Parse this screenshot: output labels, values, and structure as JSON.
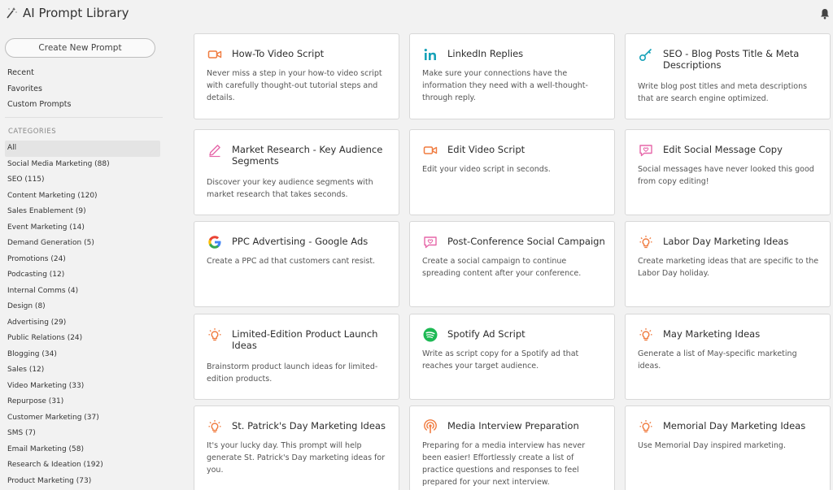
{
  "app": {
    "title": "AI Prompt Library"
  },
  "sidebar": {
    "create_label": "Create New Prompt",
    "links": [
      "Recent",
      "Favorites",
      "Custom Prompts"
    ],
    "categories_heading": "CATEGORIES",
    "categories": [
      "All",
      "Social Media Marketing (88)",
      "SEO (115)",
      "Content Marketing (120)",
      "Sales Enablement (9)",
      "Event Marketing (14)",
      "Demand Generation (5)",
      "Promotions (24)",
      "Podcasting (12)",
      "Internal Comms (4)",
      "Design (8)",
      "Advertising (29)",
      "Public Relations (24)",
      "Blogging (34)",
      "Sales (12)",
      "Video Marketing (33)",
      "Repurpose (31)",
      "Customer Marketing (37)",
      "SMS (7)",
      "Email Marketing (58)",
      "Research & Ideation (192)",
      "Product Marketing (73)"
    ]
  },
  "cards": [
    {
      "icon": "video-camera-icon",
      "title": "How-To Video Script",
      "desc": "Never miss a step in your how-to video script with carefully thought-out tutorial steps and details."
    },
    {
      "icon": "linkedin-icon",
      "title": "LinkedIn Replies",
      "desc": "Make sure your connections have the information they need with a well-thought-through reply."
    },
    {
      "icon": "key-icon",
      "title": "SEO - Blog Posts Title & Meta Descriptions",
      "desc": "Write blog post titles and meta descriptions that are search engine optimized."
    },
    {
      "icon": "pencil-icon",
      "title": "Market Research - Key Audience Segments",
      "desc": "Discover your key audience segments with market research that takes seconds."
    },
    {
      "icon": "video-camera-icon",
      "title": "Edit Video Script",
      "desc": "Edit your video script in seconds."
    },
    {
      "icon": "chat-heart-icon",
      "title": "Edit Social Message Copy",
      "desc": "Social messages have never looked this good from copy editing!"
    },
    {
      "icon": "google-icon",
      "title": "PPC Advertising - Google Ads",
      "desc": "Create a PPC ad that customers cant resist."
    },
    {
      "icon": "chat-heart-icon",
      "title": "Post-Conference Social Campaign",
      "desc": "Create a social campaign to continue spreading content after your conference."
    },
    {
      "icon": "lightbulb-icon",
      "title": "Labor Day Marketing Ideas",
      "desc": "Create marketing ideas that are specific to the Labor Day holiday."
    },
    {
      "icon": "lightbulb-icon",
      "title": "Limited-Edition Product Launch Ideas",
      "desc": "Brainstorm product launch ideas for limited-edition products."
    },
    {
      "icon": "spotify-icon",
      "title": "Spotify Ad Script",
      "desc": "Write as script copy for a Spotify ad that reaches your target audience."
    },
    {
      "icon": "lightbulb-icon",
      "title": "May Marketing Ideas",
      "desc": "Generate a list of May-specific marketing ideas."
    },
    {
      "icon": "lightbulb-icon",
      "title": "St. Patrick's Day Marketing Ideas",
      "desc": "It's your lucky day. This prompt will help generate St. Patrick's Day marketing ideas for you."
    },
    {
      "icon": "podcast-icon",
      "title": "Media Interview Preparation",
      "desc": "Preparing for a media interview has never been easier! Effortlessly create a list of practice questions and responses to feel prepared for your next interview."
    },
    {
      "icon": "lightbulb-icon",
      "title": "Memorial Day Marketing Ideas",
      "desc": "Use Memorial Day inspired marketing."
    }
  ],
  "colors": {
    "orange": "#f07b3f",
    "teal": "#17a2b8",
    "pink": "#e667a9",
    "spotify": "#1db954"
  }
}
